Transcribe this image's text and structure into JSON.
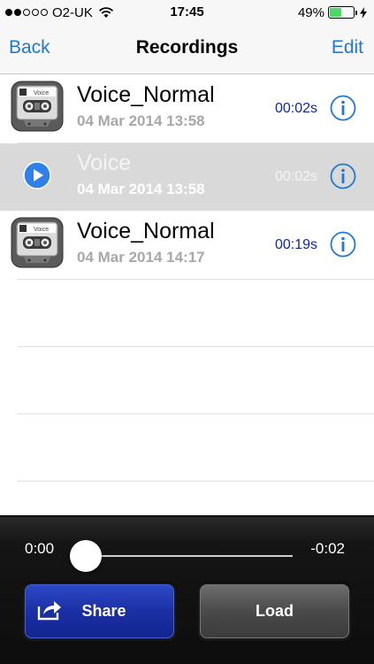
{
  "status_bar": {
    "carrier": "O2-UK",
    "time": "17:45",
    "battery_percent": "49%",
    "signal_bars_filled": 2,
    "signal_bars_total": 5,
    "battery_level": 0.49
  },
  "nav": {
    "back_label": "Back",
    "title": "Recordings",
    "edit_label": "Edit"
  },
  "recordings": [
    {
      "name": "Voice_Normal",
      "date": "04 Mar 2014 13:58",
      "duration": "00:02s",
      "icon": "cassette-icon",
      "selected": false
    },
    {
      "name": "Voice",
      "date": "04 Mar 2014 13:58",
      "duration": "00:02s",
      "icon": "play-icon",
      "selected": true
    },
    {
      "name": "Voice_Normal",
      "date": "04 Mar 2014 14:17",
      "duration": "00:19s",
      "icon": "cassette-icon",
      "selected": false
    }
  ],
  "cassette_label": "Voice",
  "player": {
    "elapsed": "0:00",
    "remaining": "-0:02",
    "progress": 0.0
  },
  "buttons": {
    "share_label": "Share",
    "load_label": "Load"
  },
  "colors": {
    "accent": "#1f78d1",
    "duration": "#1428a0",
    "selected_row": "#d9d9d9",
    "share_button": "#1a2fa3",
    "load_button": "#4a4a4a",
    "battery": "#4cd964"
  }
}
